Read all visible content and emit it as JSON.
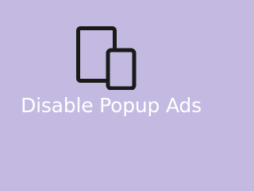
{
  "banner": {
    "background_color": "#c4b9e1",
    "icon": "tablet-and-phone-icon",
    "icon_color": "#1a1a1a",
    "title": "Disable Popup Ads",
    "title_color": "#ffffff"
  }
}
